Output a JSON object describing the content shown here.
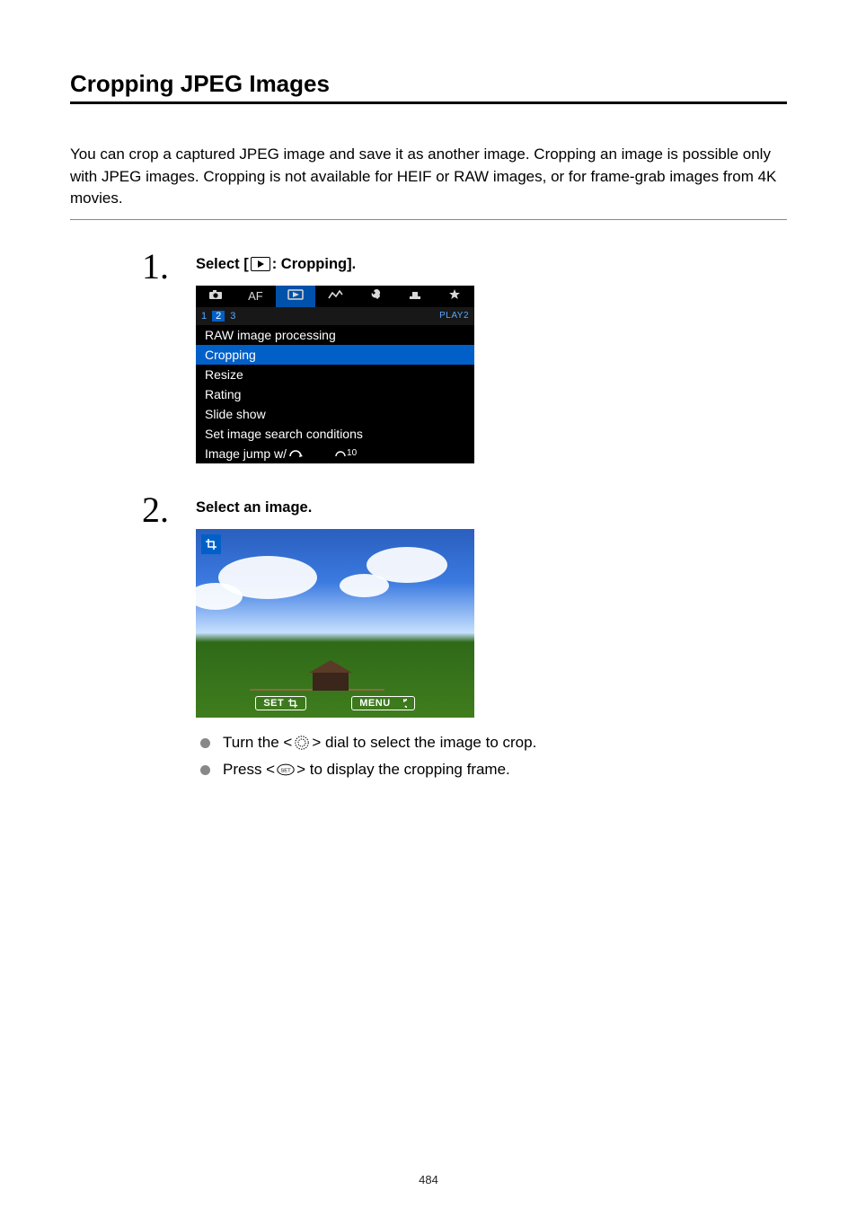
{
  "title": "Cropping JPEG Images",
  "intro": "You can crop a captured JPEG image and save it as another image. Cropping an image is possible only with JPEG images. Cropping is not available for HEIF or RAW images, or for frame-grab images from 4K movies.",
  "steps": [
    {
      "num": "1",
      "title_prefix": "Select [",
      "title_suffix": ": Cropping].",
      "menu": {
        "top_tabs": {
          "af_label": "AF"
        },
        "subtabs": {
          "pages": [
            "1",
            "2",
            "3"
          ],
          "selected": 1,
          "tag": "PLAY2"
        },
        "items": [
          "RAW image processing",
          "Cropping",
          "Resize",
          "Rating",
          "Slide show",
          "Set image search conditions"
        ],
        "selected_item_index": 1,
        "jump": {
          "label": "Image jump w/",
          "value_badge": "10"
        }
      }
    },
    {
      "num": "2",
      "title": "Select an image.",
      "preview_buttons": {
        "set": "SET",
        "menu": "MENU"
      },
      "bullets": [
        {
          "pre": "Turn the < ",
          "post": " > dial to select the image to crop.",
          "icon": "dial"
        },
        {
          "pre": "Press < ",
          "post": " > to display the cropping frame.",
          "icon": "set"
        }
      ]
    }
  ],
  "page_number": "484"
}
